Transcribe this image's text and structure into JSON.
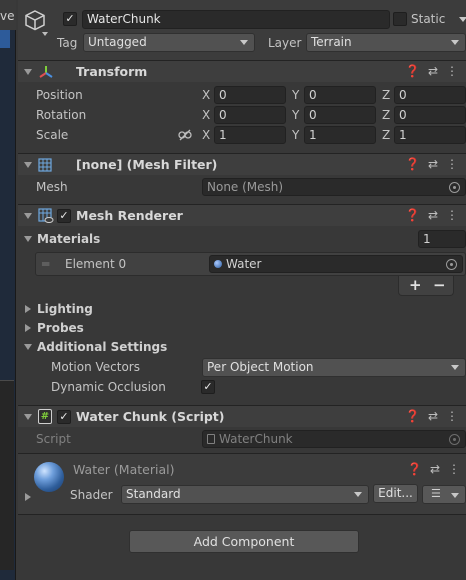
{
  "left_strip": {
    "partial_label": "ve"
  },
  "gameobject": {
    "name": "WaterChunk",
    "static_label": "Static",
    "tag_label": "Tag",
    "tag_value": "Untagged",
    "layer_label": "Layer",
    "layer_value": "Terrain"
  },
  "transform": {
    "title": "Transform",
    "position_label": "Position",
    "rotation_label": "Rotation",
    "scale_label": "Scale",
    "axis_x": "X",
    "axis_y": "Y",
    "axis_z": "Z",
    "position": {
      "x": "0",
      "y": "0",
      "z": "0"
    },
    "rotation": {
      "x": "0",
      "y": "0",
      "z": "0"
    },
    "scale": {
      "x": "1",
      "y": "1",
      "z": "1"
    }
  },
  "mesh_filter": {
    "title": "[none] (Mesh Filter)",
    "mesh_label": "Mesh",
    "mesh_value": "None (Mesh)"
  },
  "mesh_renderer": {
    "title": "Mesh Renderer",
    "materials_label": "Materials",
    "materials_count": "1",
    "element_label": "Element 0",
    "element_value": "Water",
    "add_symbol": "+",
    "remove_symbol": "−",
    "lighting_label": "Lighting",
    "probes_label": "Probes",
    "additional_label": "Additional Settings",
    "motion_vectors_label": "Motion Vectors",
    "motion_vectors_value": "Per Object Motion",
    "dynamic_occlusion_label": "Dynamic Occlusion"
  },
  "script": {
    "title": "Water Chunk (Script)",
    "script_label": "Script",
    "script_value": "WaterChunk"
  },
  "material": {
    "name": "Water (Material)",
    "shader_label": "Shader",
    "shader_value": "Standard",
    "edit_label": "Edit..."
  },
  "add_component_label": "Add Component",
  "colors": {
    "panel": "#383838",
    "header": "#3e3e3e",
    "field": "#2a2a2a",
    "accent_blue": "#2d5b9a"
  }
}
